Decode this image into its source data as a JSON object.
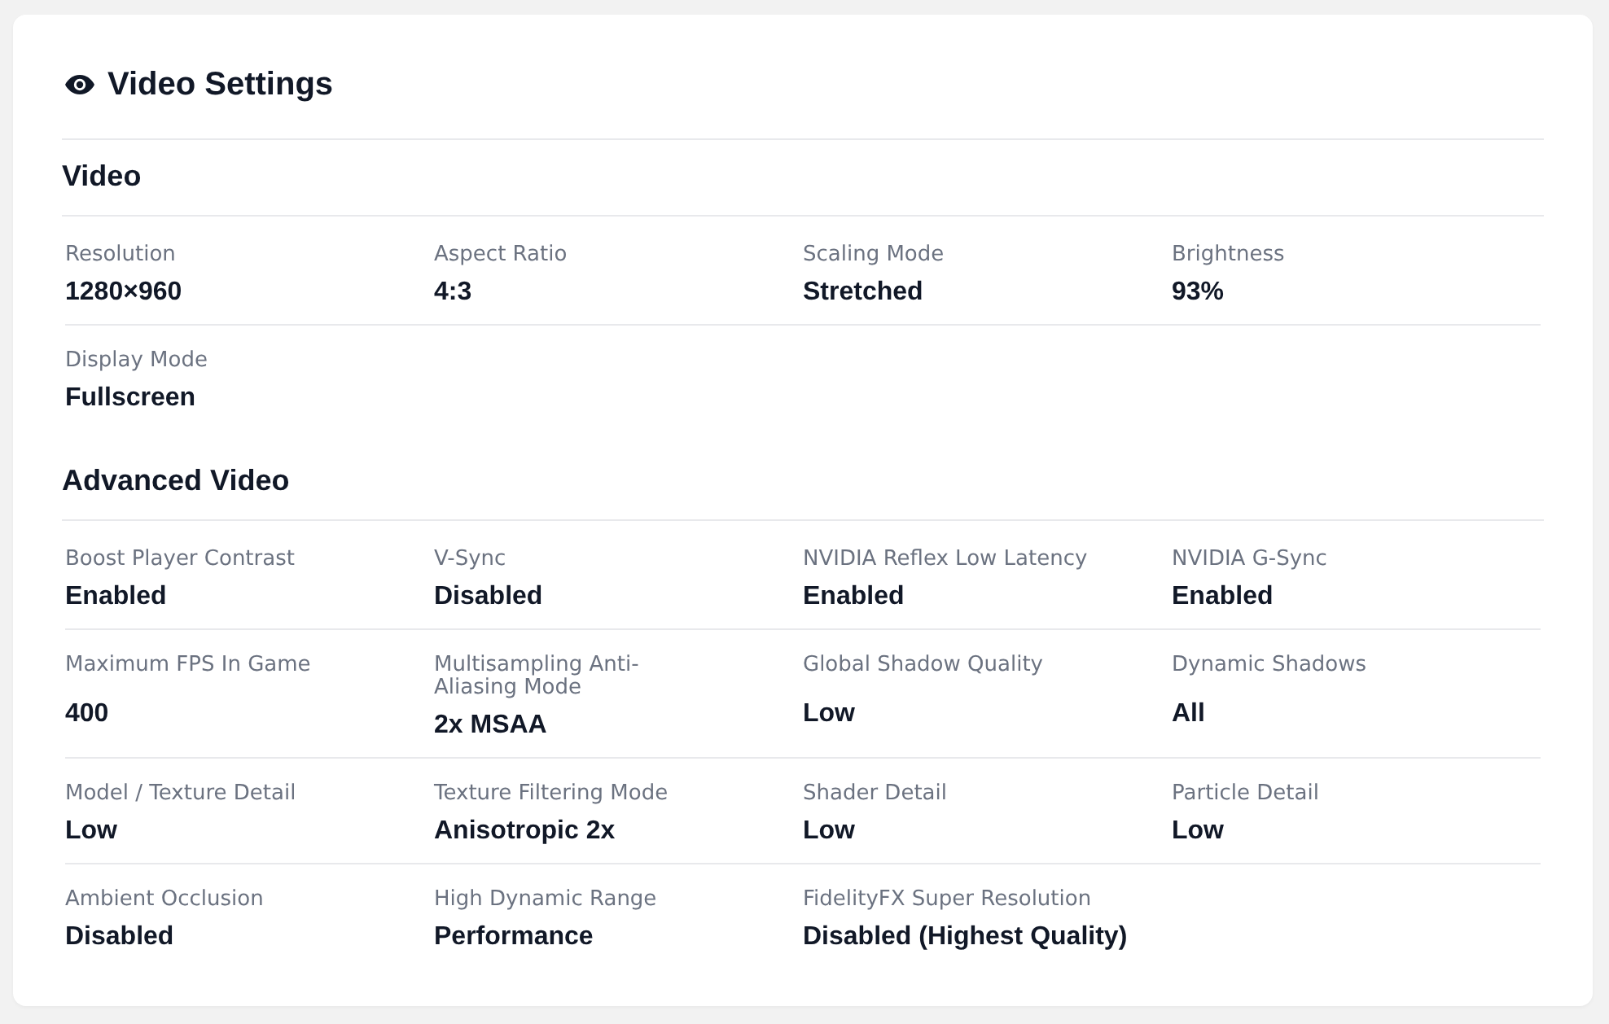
{
  "panel": {
    "title": "Video Settings"
  },
  "sections": [
    {
      "title": "Video",
      "settings": [
        {
          "label": "Resolution",
          "value": "1280×960"
        },
        {
          "label": "Aspect Ratio",
          "value": "4:3"
        },
        {
          "label": "Scaling Mode",
          "value": "Stretched"
        },
        {
          "label": "Brightness",
          "value": "93%"
        },
        {
          "label": "Display Mode",
          "value": "Fullscreen"
        }
      ]
    },
    {
      "title": "Advanced Video",
      "settings": [
        {
          "label": "Boost Player Contrast",
          "value": "Enabled"
        },
        {
          "label": "V-Sync",
          "value": "Disabled"
        },
        {
          "label": "NVIDIA Reflex Low Latency",
          "value": "Enabled"
        },
        {
          "label": "NVIDIA G-Sync",
          "value": "Enabled"
        },
        {
          "label": "Maximum FPS In Game",
          "value": "400"
        },
        {
          "label": "Multisampling Anti-Aliasing Mode",
          "value": "2x MSAA"
        },
        {
          "label": "Global Shadow Quality",
          "value": "Low"
        },
        {
          "label": "Dynamic Shadows",
          "value": "All"
        },
        {
          "label": "Model / Texture Detail",
          "value": "Low"
        },
        {
          "label": "Texture Filtering Mode",
          "value": "Anisotropic 2x"
        },
        {
          "label": "Shader Detail",
          "value": "Low"
        },
        {
          "label": "Particle Detail",
          "value": "Low"
        },
        {
          "label": "Ambient Occlusion",
          "value": "Disabled"
        },
        {
          "label": "High Dynamic Range",
          "value": "Performance"
        },
        {
          "label": "FidelityFX Super Resolution",
          "value": "Disabled (Highest Quality)"
        }
      ]
    }
  ]
}
